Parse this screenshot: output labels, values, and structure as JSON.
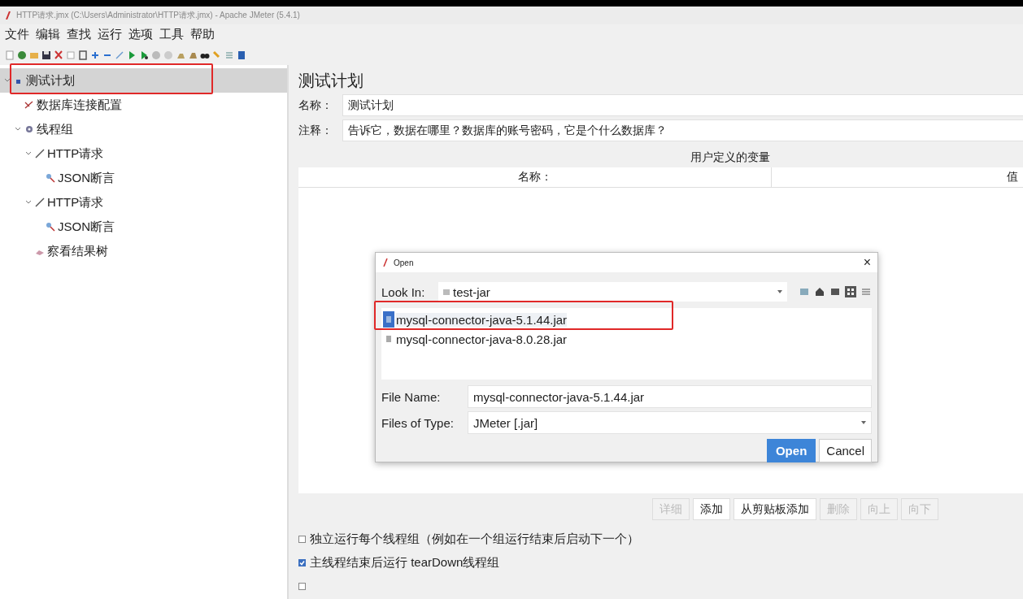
{
  "window": {
    "title": "HTTP请求.jmx (C:\\Users\\Administrator\\HTTP请求.jmx) - Apache JMeter (5.4.1)"
  },
  "menu": [
    "文件",
    "编辑",
    "查找",
    "运行",
    "选项",
    "工具",
    "帮助"
  ],
  "tree": [
    {
      "label": "测试计划",
      "kind": "plan",
      "selected": true,
      "expanded": true,
      "children": [
        {
          "label": "数据库连接配置",
          "kind": "config",
          "selected": false
        },
        {
          "label": "线程组",
          "kind": "threads",
          "selected": false,
          "expanded": true,
          "children": [
            {
              "label": "HTTP请求",
              "kind": "sampler",
              "selected": false,
              "expanded": true,
              "children": [
                {
                  "label": "JSON断言",
                  "kind": "assertion",
                  "selected": false
                }
              ]
            },
            {
              "label": "HTTP请求",
              "kind": "sampler",
              "selected": false,
              "expanded": true,
              "children": [
                {
                  "label": "JSON断言",
                  "kind": "assertion",
                  "selected": false
                }
              ]
            },
            {
              "label": "察看结果树",
              "kind": "listener",
              "selected": false
            }
          ]
        }
      ]
    }
  ],
  "panel": {
    "title": "测试计划",
    "fields": [
      {
        "label": "名称：",
        "value": "测试计划"
      },
      {
        "label": "注释：",
        "value": "告诉它，数据在哪里？数据库的账号密码，它是个什么数据库？"
      }
    ],
    "table": {
      "caption": "用户定义的变量",
      "columns": [
        "名称：",
        "值"
      ]
    },
    "buttons": [
      {
        "label": "详细",
        "disabled": true
      },
      {
        "label": "添加",
        "disabled": false
      },
      {
        "label": "从剪贴板添加",
        "disabled": false
      },
      {
        "label": "删除",
        "disabled": true
      },
      {
        "label": "向上",
        "disabled": true
      },
      {
        "label": "向下",
        "disabled": true
      }
    ],
    "options": [
      {
        "label": "独立运行每个线程组（例如在一个组运行结束后启动下一个）",
        "checked": false
      },
      {
        "label": "主线程结束后运行 tearDown线程组",
        "checked": true
      },
      {
        "checked": false
      }
    ]
  },
  "dialog": {
    "title": "Open",
    "close": "×",
    "look_in": {
      "label": "Look In:",
      "value": "test-jar"
    },
    "files": [
      {
        "name": "mysql-connector-java-5.1.44.jar",
        "selected": true
      },
      {
        "name": "mysql-connector-java-8.0.28.jar",
        "selected": false
      }
    ],
    "file_name": {
      "label": "File Name:",
      "value": "mysql-connector-java-5.1.44.jar"
    },
    "file_type": {
      "label": "Files of Type:",
      "value": "JMeter [.jar]"
    },
    "buttons": [
      {
        "label": "Open",
        "kind": "primary"
      },
      {
        "label": "Cancel",
        "kind": "default"
      }
    ]
  },
  "highlights": [
    {
      "kind": "rectangle"
    },
    {
      "kind": "rectangle"
    }
  ]
}
